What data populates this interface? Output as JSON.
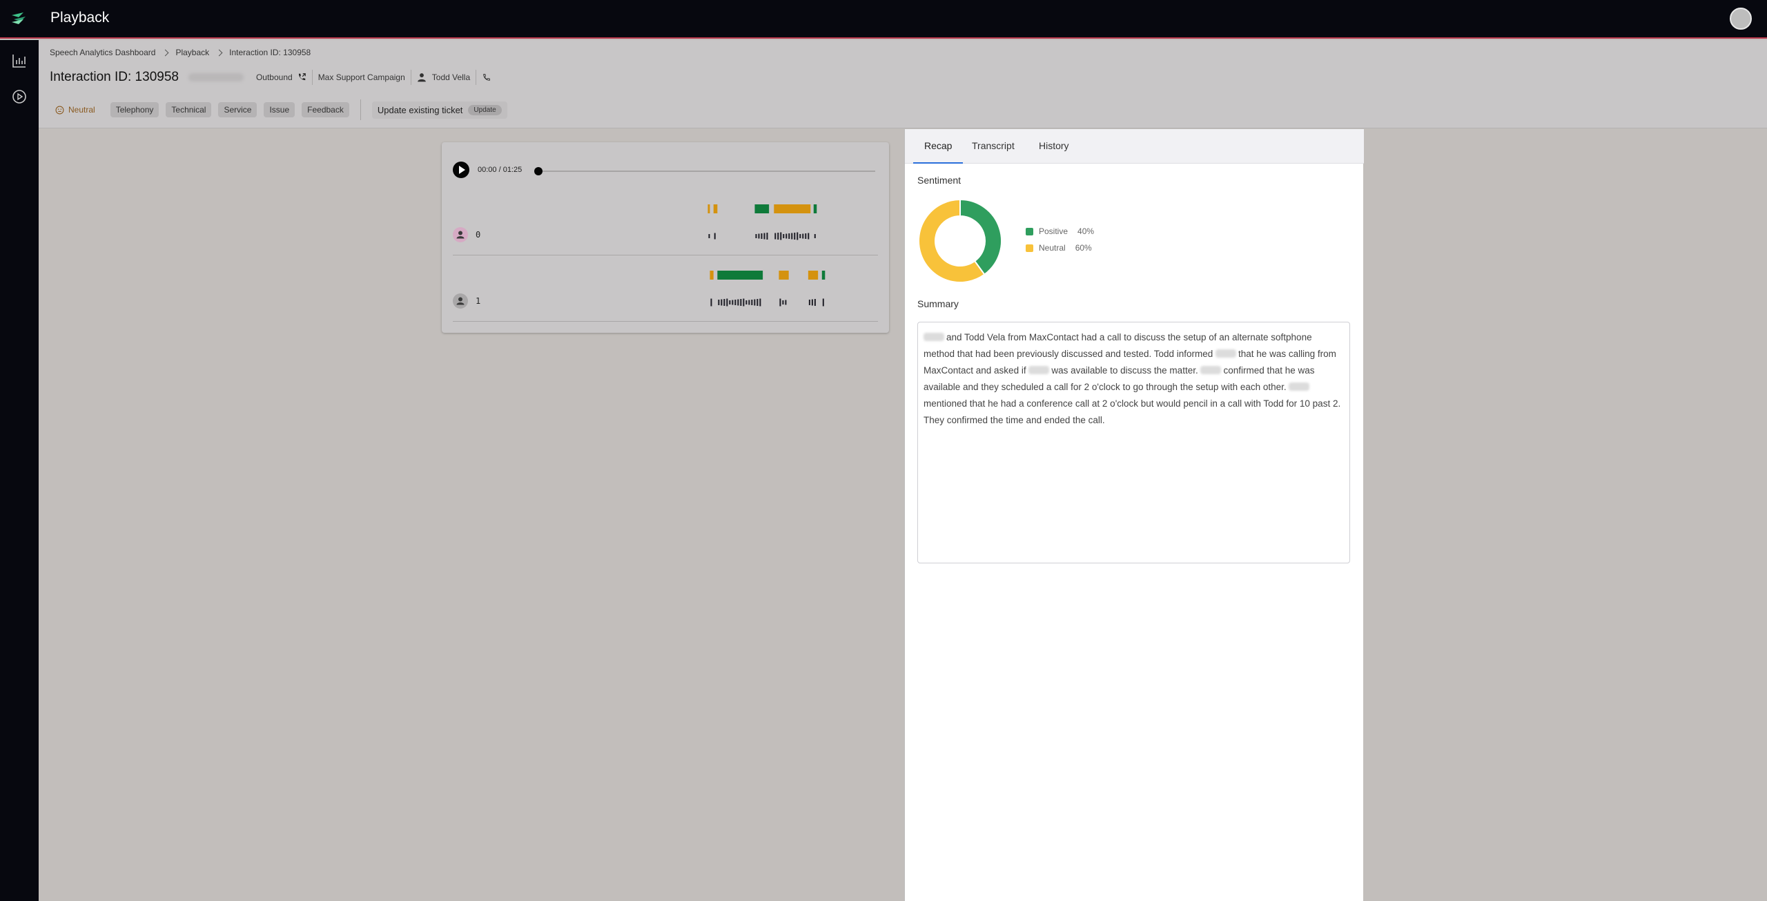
{
  "app": {
    "title": "Playback"
  },
  "breadcrumb": {
    "items": [
      "Speech Analytics Dashboard",
      "Playback",
      "Interaction ID: 130958"
    ]
  },
  "interaction": {
    "title": "Interaction ID: 130958",
    "direction": "Outbound",
    "campaign": "Max Support Campaign",
    "agent": "Todd Vella"
  },
  "tags": {
    "sentiment": "Neutral",
    "items": [
      "Telephony",
      "Technical",
      "Service",
      "Issue",
      "Feedback"
    ]
  },
  "ticket": {
    "label": "Update existing ticket",
    "button": "Update"
  },
  "player": {
    "time": "00:00 / 01:25",
    "progress": 0,
    "speakers": [
      {
        "label": "0",
        "color": "#d6aac4",
        "sentiment_segments": [
          {
            "start": 0.6,
            "end": 0.608,
            "color": "#d4920f"
          },
          {
            "start": 0.622,
            "end": 0.637,
            "color": "#d4920f"
          },
          {
            "start": 0.781,
            "end": 0.836,
            "color": "#0f7a3a"
          },
          {
            "start": 0.855,
            "end": 0.996,
            "color": "#d4920f"
          },
          {
            "start": 1.008,
            "end": 1.02,
            "color": "#0f7a3a"
          }
        ]
      },
      {
        "label": "1",
        "color": "#a9a7a8",
        "sentiment_segments": [
          {
            "start": 0.608,
            "end": 0.622,
            "color": "#d4920f"
          },
          {
            "start": 0.637,
            "end": 0.812,
            "color": "#0f7a3a"
          },
          {
            "start": 0.874,
            "end": 0.912,
            "color": "#d4920f"
          },
          {
            "start": 0.987,
            "end": 1.025,
            "color": "#d4920f"
          },
          {
            "start": 1.04,
            "end": 1.052,
            "color": "#0f7a3a"
          }
        ]
      }
    ]
  },
  "panel": {
    "tabs": [
      "Recap",
      "Transcript",
      "History"
    ],
    "active_tab": "Recap",
    "sentiment_title": "Sentiment",
    "summary_title": "Summary",
    "sentiment": [
      {
        "name": "Positive",
        "value": 40,
        "label": "40%",
        "color": "#2f9e5e"
      },
      {
        "name": "Neutral",
        "value": 60,
        "label": "60%",
        "color": "#f8c23a"
      }
    ],
    "summary": [
      {
        "text": "and Todd Vela from MaxContact had a call to discuss the setup of an alternate softphone method that had been previously discussed and tested. Todd informed ",
        "redacted": true
      },
      {
        "text": "that he was calling from MaxContact and asked if ",
        "redacted": true
      },
      {
        "text": "was available to discuss the matter. ",
        "redacted": true
      },
      {
        "text": "confirmed that he was available and they scheduled a call for 2 o'clock to go through the setup with each other. ",
        "redacted": true
      },
      {
        "text": "mentioned that he had a conference call at 2 o'clock but would pencil in a call with Todd for 10 past 2. They confirmed the time and ended the call.",
        "redacted": false
      }
    ]
  }
}
